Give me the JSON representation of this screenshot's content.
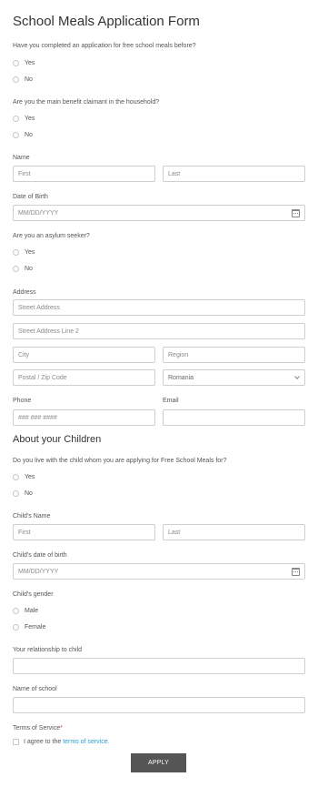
{
  "form": {
    "title": "School Meals Application Form",
    "q_prev_application": {
      "label": "Have you completed an application for free school meals before?",
      "options": [
        "Yes",
        "No"
      ]
    },
    "q_benefit_claimant": {
      "label": "Are you the main benefit claimant in the household?",
      "options": [
        "Yes",
        "No"
      ]
    },
    "name": {
      "label": "Name",
      "first_placeholder": "First",
      "last_placeholder": "Last"
    },
    "dob": {
      "label": "Date of Birth",
      "placeholder": "MM/DD/YYYY",
      "icon": "calendar-icon"
    },
    "q_asylum": {
      "label": "Are you an asylum seeker?",
      "options": [
        "Yes",
        "No"
      ]
    },
    "address": {
      "label": "Address",
      "street_placeholder": "Street Address",
      "street2_placeholder": "Street Address Line 2",
      "city_placeholder": "City",
      "region_placeholder": "Region",
      "postal_placeholder": "Postal / Zip Code",
      "country_value": "Romania",
      "country_icon": "chevron-down-icon"
    },
    "phone": {
      "label": "Phone",
      "placeholder": "### ### ####"
    },
    "email": {
      "label": "Email",
      "placeholder": ""
    }
  },
  "children": {
    "title": "About your Children",
    "q_live_with_child": {
      "label": "Do you live with the child whom you are applying for Free School Meals for?",
      "options": [
        "Yes",
        "No"
      ]
    },
    "child_name": {
      "label": "Child's Name",
      "first_placeholder": "First",
      "last_placeholder": "Last"
    },
    "child_dob": {
      "label": "Child's date of birth",
      "placeholder": "MM/DD/YYYY",
      "icon": "calendar-icon"
    },
    "child_gender": {
      "label": "Child's gender",
      "options": [
        "Male",
        "Female"
      ]
    },
    "relationship": {
      "label": "Your relationship to child"
    },
    "school": {
      "label": "Name of school"
    },
    "terms": {
      "label": "Terms of Service",
      "required_marker": "*",
      "agree_text": "I agree to the",
      "link_text": "terms of service."
    },
    "apply_label": "APPLY"
  },
  "colors": {
    "link": "#2a9fd6",
    "required": "#e53935",
    "button_bg": "#555555"
  }
}
